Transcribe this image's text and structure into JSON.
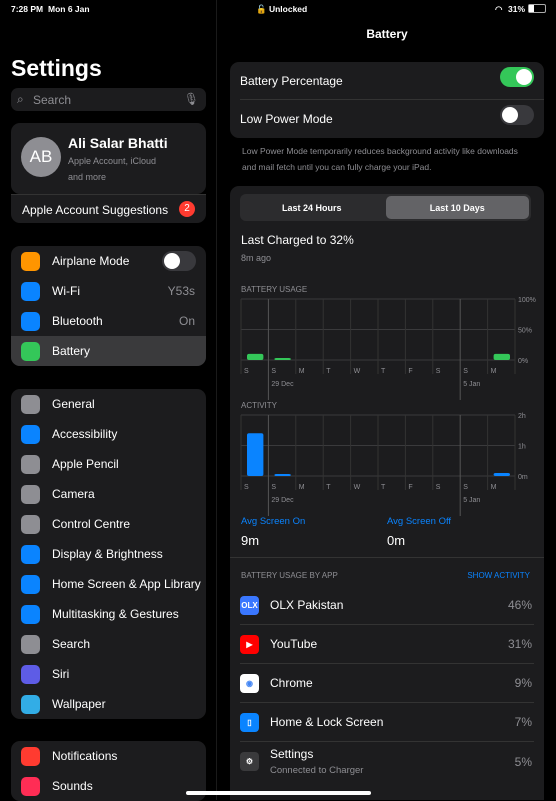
{
  "status": {
    "time": "7:28 PM",
    "date": "Mon 6 Jan",
    "lock": "Unlocked",
    "battery": "31%"
  },
  "sidebar": {
    "title": "Settings",
    "search_placeholder": "Search",
    "account": {
      "initials": "AB",
      "name": "Ali Salar Bhatti",
      "sub1": "Apple Account, iCloud",
      "sub2": "and more",
      "suggestions": "Apple Account Suggestions",
      "badge": "2"
    },
    "group1": [
      {
        "label": "Airplane Mode",
        "icon": "airplane-icon",
        "color": "#ff9500",
        "toggle": false
      },
      {
        "label": "Wi-Fi",
        "icon": "wifi-icon",
        "color": "#0a84ff",
        "value": "Y53s"
      },
      {
        "label": "Bluetooth",
        "icon": "bluetooth-icon",
        "color": "#0a84ff",
        "value": "On"
      },
      {
        "label": "Battery",
        "icon": "battery-icon",
        "color": "#34c759",
        "selected": true
      }
    ],
    "group2": [
      {
        "label": "General",
        "icon": "gear-icon",
        "color": "#8e8e93"
      },
      {
        "label": "Accessibility",
        "icon": "accessibility-icon",
        "color": "#0a84ff"
      },
      {
        "label": "Apple Pencil",
        "icon": "pencil-icon",
        "color": "#8e8e93"
      },
      {
        "label": "Camera",
        "icon": "camera-icon",
        "color": "#8e8e93"
      },
      {
        "label": "Control Centre",
        "icon": "control-centre-icon",
        "color": "#8e8e93"
      },
      {
        "label": "Display & Brightness",
        "icon": "brightness-icon",
        "color": "#0a84ff"
      },
      {
        "label": "Home Screen & App Library",
        "icon": "home-screen-icon",
        "color": "#0a84ff"
      },
      {
        "label": "Multitasking & Gestures",
        "icon": "multitasking-icon",
        "color": "#0a84ff"
      },
      {
        "label": "Search",
        "icon": "search-icon",
        "color": "#8e8e93"
      },
      {
        "label": "Siri",
        "icon": "siri-icon",
        "color": "#5e5ce6"
      },
      {
        "label": "Wallpaper",
        "icon": "wallpaper-icon",
        "color": "#32ade6"
      }
    ],
    "group3": [
      {
        "label": "Notifications",
        "icon": "bell-icon",
        "color": "#ff3b30"
      },
      {
        "label": "Sounds",
        "icon": "speaker-icon",
        "color": "#ff2d55"
      }
    ]
  },
  "main": {
    "title": "Battery",
    "battery_percentage": {
      "label": "Battery Percentage",
      "on": true
    },
    "low_power": {
      "label": "Low Power Mode",
      "on": false
    },
    "low_power_note": "Low Power Mode temporarily reduces background activity like downloads and mail fetch until you can fully charge your iPad.",
    "tabs": [
      "Last 24 Hours",
      "Last 10 Days"
    ],
    "last_charged": "Last Charged to 32%",
    "last_charged_ago": "8m ago",
    "avg_on_label": "Avg Screen On",
    "avg_on": "9m",
    "avg_off_label": "Avg Screen Off",
    "avg_off": "0m",
    "by_app": "BATTERY USAGE BY APP",
    "show_activity": "SHOW ACTIVITY",
    "apps": [
      {
        "name": "OLX Pakistan",
        "pct": "46%",
        "color": "#3a77ff",
        "icon": "olx-icon",
        "glyph": "OLX"
      },
      {
        "name": "YouTube",
        "pct": "31%",
        "color": "#ff0000",
        "icon": "youtube-icon",
        "glyph": "▶"
      },
      {
        "name": "Chrome",
        "pct": "9%",
        "color": "#ffffff",
        "icon": "chrome-icon",
        "glyph": "◉"
      },
      {
        "name": "Home & Lock Screen",
        "pct": "7%",
        "color": "#0a84ff",
        "icon": "home-lock-icon",
        "glyph": "▯"
      },
      {
        "name": "Settings",
        "sub": "Connected to Charger",
        "pct": "5%",
        "color": "#3a3a3c",
        "icon": "settings-gear-icon",
        "glyph": "⚙"
      }
    ]
  },
  "chart_data": [
    {
      "type": "bar",
      "title": "BATTERY USAGE",
      "categories": [
        "S",
        "S",
        "M",
        "T",
        "W",
        "T",
        "F",
        "S",
        "S",
        "M"
      ],
      "date_labels": [
        "29 Dec",
        "5 Jan"
      ],
      "values": [
        10,
        2,
        0,
        0,
        0,
        0,
        0,
        0,
        0,
        10
      ],
      "yticks": [
        "100%",
        "50%",
        "0%"
      ],
      "ylim": [
        0,
        100
      ],
      "color": "#34c759"
    },
    {
      "type": "bar",
      "title": "ACTIVITY",
      "categories": [
        "S",
        "S",
        "M",
        "T",
        "W",
        "T",
        "F",
        "S",
        "S",
        "M"
      ],
      "date_labels": [
        "29 Dec",
        "5 Jan"
      ],
      "values": [
        1.4,
        0.03,
        0,
        0,
        0,
        0,
        0,
        0,
        0,
        0.1
      ],
      "yticks": [
        "2h",
        "1h",
        "0m"
      ],
      "ylim": [
        0,
        2
      ],
      "color": "#0a84ff"
    }
  ]
}
